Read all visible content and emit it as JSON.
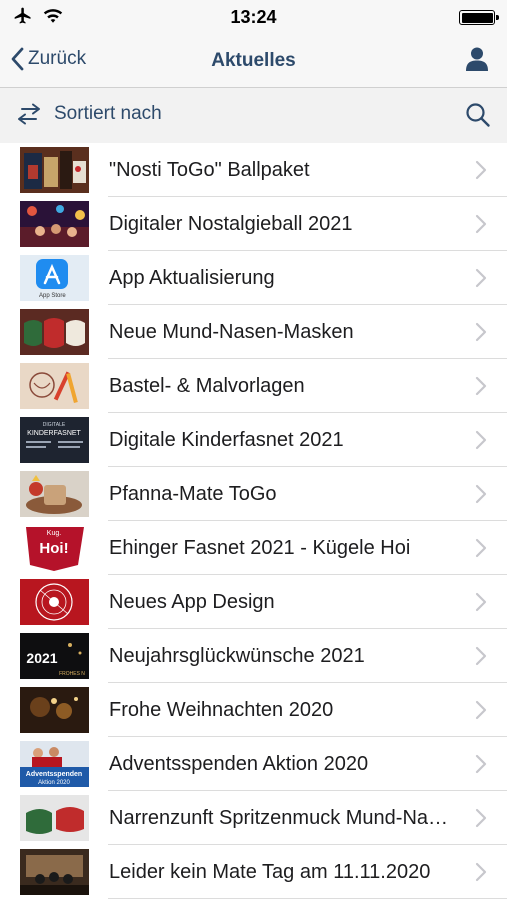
{
  "status_bar": {
    "time": "13:24",
    "icons": [
      "airplane-icon",
      "wifi-icon",
      "battery-icon"
    ]
  },
  "nav": {
    "back_label": "Zurück",
    "title": "Aktuelles",
    "right_icon": "user-icon",
    "accent_color": "#2d4a6b"
  },
  "sort_bar": {
    "label": "Sortiert nach",
    "left_icon": "sort-arrows-icon",
    "right_icon": "search-icon"
  },
  "items": [
    {
      "title": "\"Nosti ToGo\" Ballpaket",
      "thumb": "ballpaket"
    },
    {
      "title": "Digitaler Nostalgieball 2021",
      "thumb": "party"
    },
    {
      "title": "App Aktualisierung",
      "thumb": "appstore"
    },
    {
      "title": "Neue Mund-Nasen-Masken",
      "thumb": "masks"
    },
    {
      "title": "Bastel- & Malvorlagen",
      "thumb": "drawing"
    },
    {
      "title": "Digitale Kinderfasnet 2021",
      "thumb": "kinderfasnet"
    },
    {
      "title": "Pfanna-Mate ToGo",
      "thumb": "mate"
    },
    {
      "title": "Ehinger Fasnet 2021 - Kügele Hoi",
      "thumb": "hoi"
    },
    {
      "title": "Neues App Design",
      "thumb": "logo"
    },
    {
      "title": "Neujahrsglückwünsche 2021",
      "thumb": "newyear"
    },
    {
      "title": "Frohe Weihnachten 2020",
      "thumb": "christmas"
    },
    {
      "title": "Adventsspenden Aktion 2020",
      "thumb": "advent"
    },
    {
      "title": "Narrenzunft Spritzenmuck Mund-Nasen-Masken",
      "thumb": "masks2"
    },
    {
      "title": "Leider kein Mate Tag am 11.11.2020",
      "thumb": "matetag"
    }
  ],
  "thumb_text": {
    "appstore": "App Store",
    "kinderfasnet": "KINDERFASNET",
    "kinderfasnet_sub": "DIGITALE",
    "hoi": "Hoi!",
    "hoi_sub": "Kug.",
    "newyear": "2021",
    "newyear_sub": "FROHES N",
    "advent": "Adventsspenden",
    "advent_sub": "Aktion 2020"
  }
}
